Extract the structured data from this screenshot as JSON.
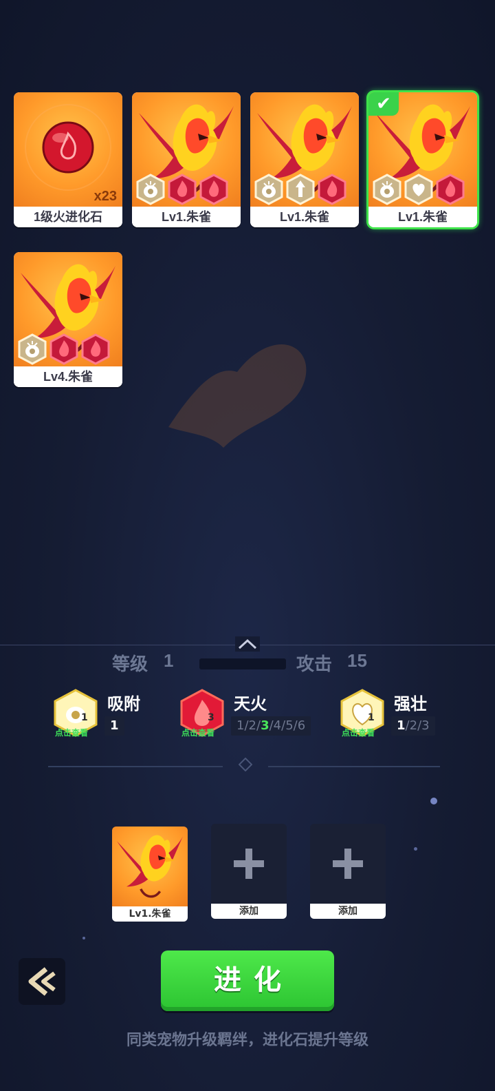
{
  "colors": {
    "accent_green": "#3fe34a",
    "card_orange": "#ff9a2a",
    "background": "#151c33",
    "level_highlight": "#49e55a"
  },
  "inventory": [
    {
      "type": "item",
      "label": "1级火进化石",
      "qty": "x23",
      "selected": false,
      "badges": []
    },
    {
      "type": "pet",
      "label": "Lv1.朱雀",
      "selected": false,
      "badges": [
        "absorb-icon",
        "fire-icon",
        "flame-icon"
      ]
    },
    {
      "type": "pet",
      "label": "Lv1.朱雀",
      "selected": false,
      "badges": [
        "absorb-icon",
        "arrow-up-icon",
        "flame-icon"
      ]
    },
    {
      "type": "pet",
      "label": "Lv1.朱雀",
      "selected": true,
      "badges": [
        "absorb-icon",
        "heart-icon",
        "flame-icon"
      ]
    },
    {
      "type": "pet",
      "label": "Lv4.朱雀",
      "selected": false,
      "badges": [
        "absorb-icon",
        "fire-icon",
        "flame-icon"
      ]
    }
  ],
  "stats": {
    "level_label": "等级",
    "level_value": "1",
    "attack_label": "攻击",
    "attack_value": "15"
  },
  "skills": [
    {
      "name": "吸附",
      "icon": "absorb-icon",
      "count": "1",
      "tap_hint": "点击查看",
      "levels": [
        "1"
      ],
      "current": 0
    },
    {
      "name": "天火",
      "icon": "fire-icon",
      "count": "3",
      "tap_hint": "点击查看",
      "levels": [
        "1",
        "2",
        "3",
        "4",
        "5",
        "6"
      ],
      "current": 2
    },
    {
      "name": "强壮",
      "icon": "heart-icon",
      "count": "1",
      "tap_hint": "点击查看",
      "levels": [
        "1",
        "2",
        "3"
      ],
      "current": 0
    }
  ],
  "slots": [
    {
      "filled": true,
      "label": "Lv1.朱雀"
    },
    {
      "filled": false,
      "label": "添加"
    },
    {
      "filled": false,
      "label": "添加"
    }
  ],
  "evolve_button": "进化",
  "hint": "同类宠物升级羁绊，进化石提升等级"
}
